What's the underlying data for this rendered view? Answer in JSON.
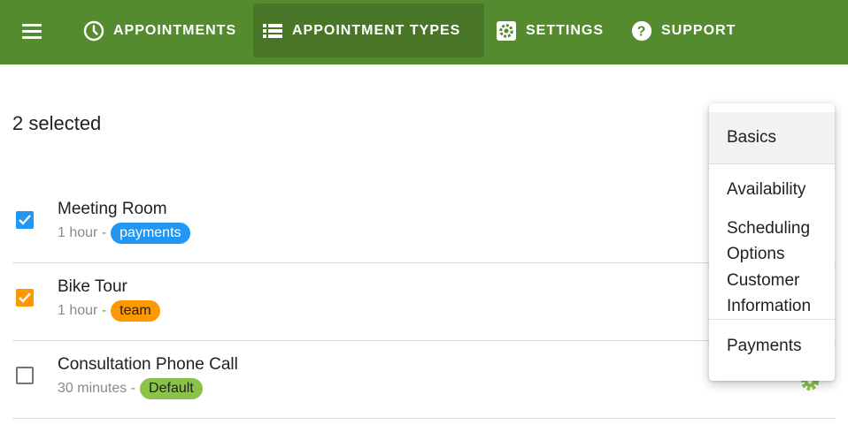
{
  "nav": {
    "items": [
      {
        "label": "APPOINTMENTS",
        "icon": "clock-icon"
      },
      {
        "label": "APPOINTMENT TYPES",
        "icon": "list-icon",
        "active": true
      },
      {
        "label": "SETTINGS",
        "icon": "settings-icon"
      },
      {
        "label": "SUPPORT",
        "icon": "help-icon"
      }
    ]
  },
  "selection": {
    "title": "2 selected"
  },
  "rows": [
    {
      "title": "Meeting Room",
      "duration": "1 hour -",
      "tag": "payments",
      "tag_color": "#2196f3",
      "tag_text_color": "#ffffff",
      "checked": true,
      "check_color": "#2196f3"
    },
    {
      "title": "Bike Tour",
      "duration": "1 hour -",
      "tag": "team",
      "tag_color": "#ff9800",
      "tag_text_color": "#212121",
      "checked": true,
      "check_color": "#ff9800"
    },
    {
      "title": "Consultation Phone Call",
      "duration": "30 minutes -",
      "tag": "Default",
      "tag_color": "#8bc34a",
      "tag_text_color": "#212121",
      "checked": false,
      "check_color": "#757575"
    }
  ],
  "dropdown": {
    "items": [
      "Basics",
      "Availability",
      "Scheduling Options",
      "Customer Information",
      "Payments"
    ],
    "scheduling_line1": "Scheduling",
    "scheduling_line2": "Options",
    "customer_line1": "Customer",
    "customer_line2": "Information"
  },
  "colors": {
    "topbar": "#558b2f",
    "accent": "#8bc34a"
  }
}
